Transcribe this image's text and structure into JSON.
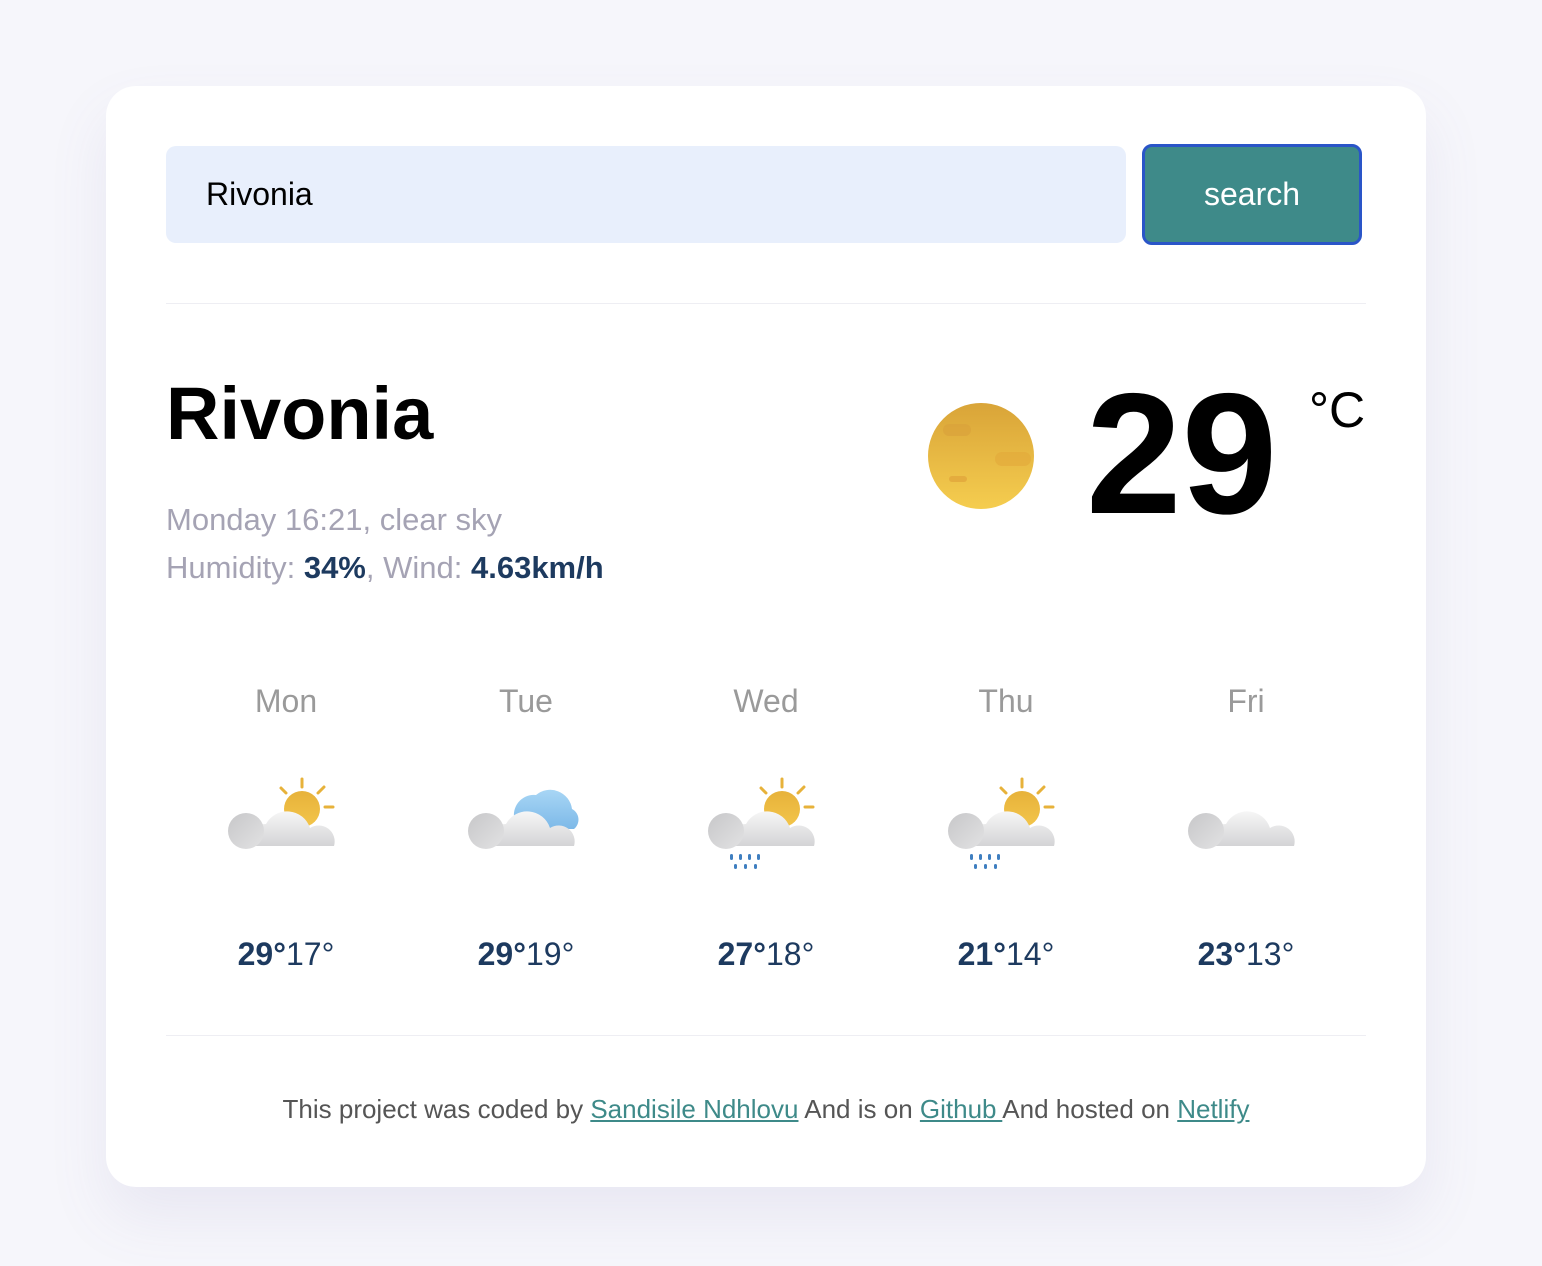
{
  "search": {
    "value": "Rivonia",
    "button_label": "search"
  },
  "current": {
    "city": "Rivonia",
    "date_time": "Monday 16:21",
    "description": "clear sky",
    "humidity_label": "Humidity:",
    "humidity_value": "34%",
    "wind_label": "Wind:",
    "wind_value": "4.63km/h",
    "temperature": "29",
    "unit": "°C",
    "icon": "clear-sky-icon"
  },
  "forecast": [
    {
      "day": "Mon",
      "max": "29°",
      "min": "17°",
      "icon": "partly-cloudy-icon"
    },
    {
      "day": "Tue",
      "max": "29°",
      "min": "19°",
      "icon": "broken-clouds-icon"
    },
    {
      "day": "Wed",
      "max": "27°",
      "min": "18°",
      "icon": "sun-rain-icon"
    },
    {
      "day": "Thu",
      "max": "21°",
      "min": "14°",
      "icon": "sun-rain-icon"
    },
    {
      "day": "Fri",
      "max": "23°",
      "min": "13°",
      "icon": "cloud-icon"
    }
  ],
  "footer": {
    "text1": "This project was coded by ",
    "author": "Sandisile Ndhlovu",
    "text2": " And is on ",
    "github": "Github ",
    "text3": "And hosted on ",
    "netlify": "Netlify"
  },
  "colors": {
    "accent": "#3e8a89",
    "value": "#1d3a5f",
    "muted": "#a5a3b4"
  }
}
